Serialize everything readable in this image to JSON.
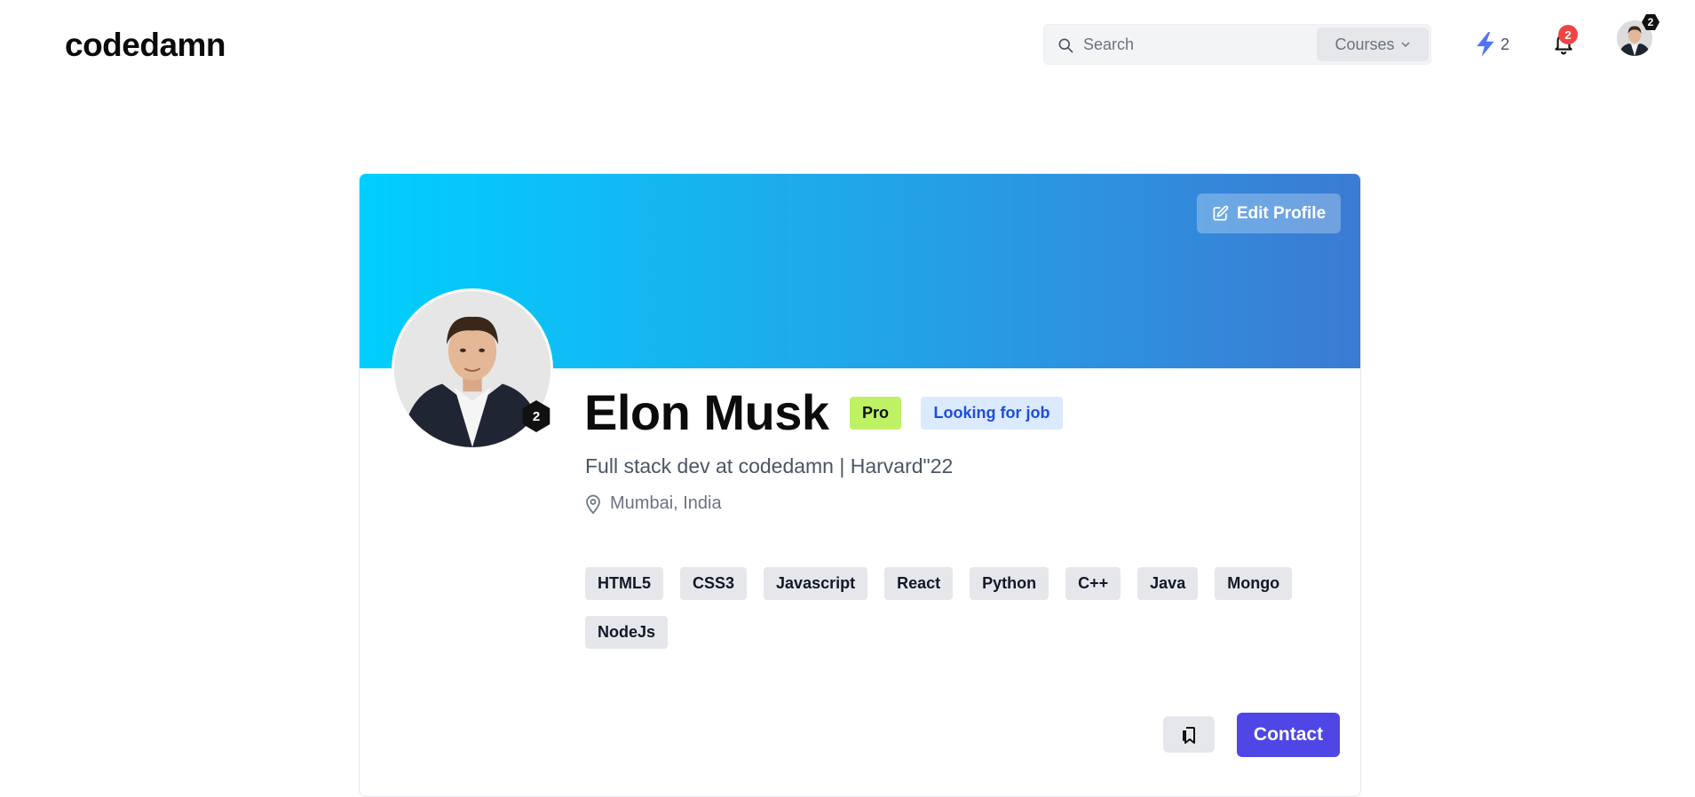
{
  "header": {
    "logo": "codedamn",
    "search": {
      "placeholder": "Search",
      "scope_label": "Courses"
    },
    "streak_count": "2",
    "notification_count": "2",
    "avatar_level": "2"
  },
  "profile": {
    "edit_label": "Edit Profile",
    "name": "Elon Musk",
    "level": "2",
    "badges": {
      "pro": "Pro",
      "job": "Looking for job"
    },
    "headline": "Full stack dev at codedamn | Harvard\"22",
    "location": "Mumbai, India",
    "skills": [
      "HTML5",
      "CSS3",
      "Javascript",
      "React",
      "Python",
      "C++",
      "Java",
      "Mongo",
      "NodeJs"
    ],
    "contact_label": "Contact"
  },
  "colors": {
    "accent": "#4f46e5",
    "cover_start": "#00cffc",
    "cover_end": "#3b7bd4",
    "pro_badge": "#bef264",
    "job_badge_bg": "#dbeafe",
    "job_badge_text": "#1d4ed8",
    "notification": "#ef4444"
  },
  "icons": {
    "search": "search-icon",
    "chevron": "chevron-down-icon",
    "streak": "lightning-icon",
    "notifications": "bell-icon",
    "edit": "edit-icon",
    "location": "map-pin-icon",
    "bookmark": "bookmark-icon"
  }
}
